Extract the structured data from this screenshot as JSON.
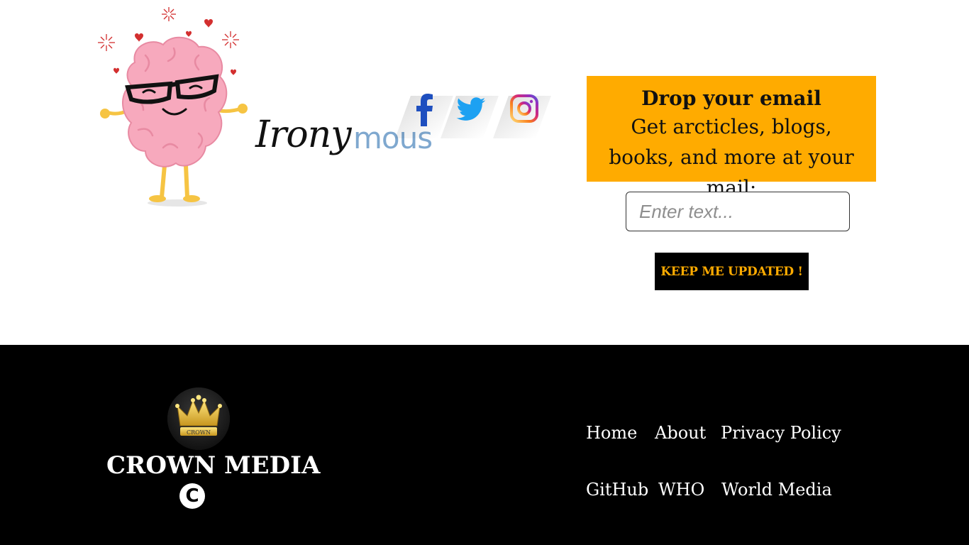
{
  "header": {
    "brand_wordmark_part1": "Irony",
    "brand_wordmark_part2": "mous",
    "social": [
      {
        "name": "facebook-icon",
        "color": "#1877f2"
      },
      {
        "name": "twitter-icon",
        "color": "#1da1f2"
      },
      {
        "name": "instagram-icon",
        "color": "#e1306c"
      }
    ]
  },
  "newsletter": {
    "heading": "Drop your email",
    "body": "Get arcticles, blogs, books, and more at your mail:",
    "input_placeholder": "Enter text...",
    "input_value": "",
    "button_label": "KEEP ME UPDATED !",
    "accent_color": "#ffab00"
  },
  "footer": {
    "brand": "CROWN MEDIA",
    "logo_text": "CROWN",
    "copyright_symbol": "C",
    "links": [
      {
        "label": "Home"
      },
      {
        "label": "About"
      },
      {
        "label": "Privacy Policy"
      },
      {
        "label": "GitHub"
      },
      {
        "label": "WHO"
      },
      {
        "label": "World Media"
      }
    ]
  }
}
